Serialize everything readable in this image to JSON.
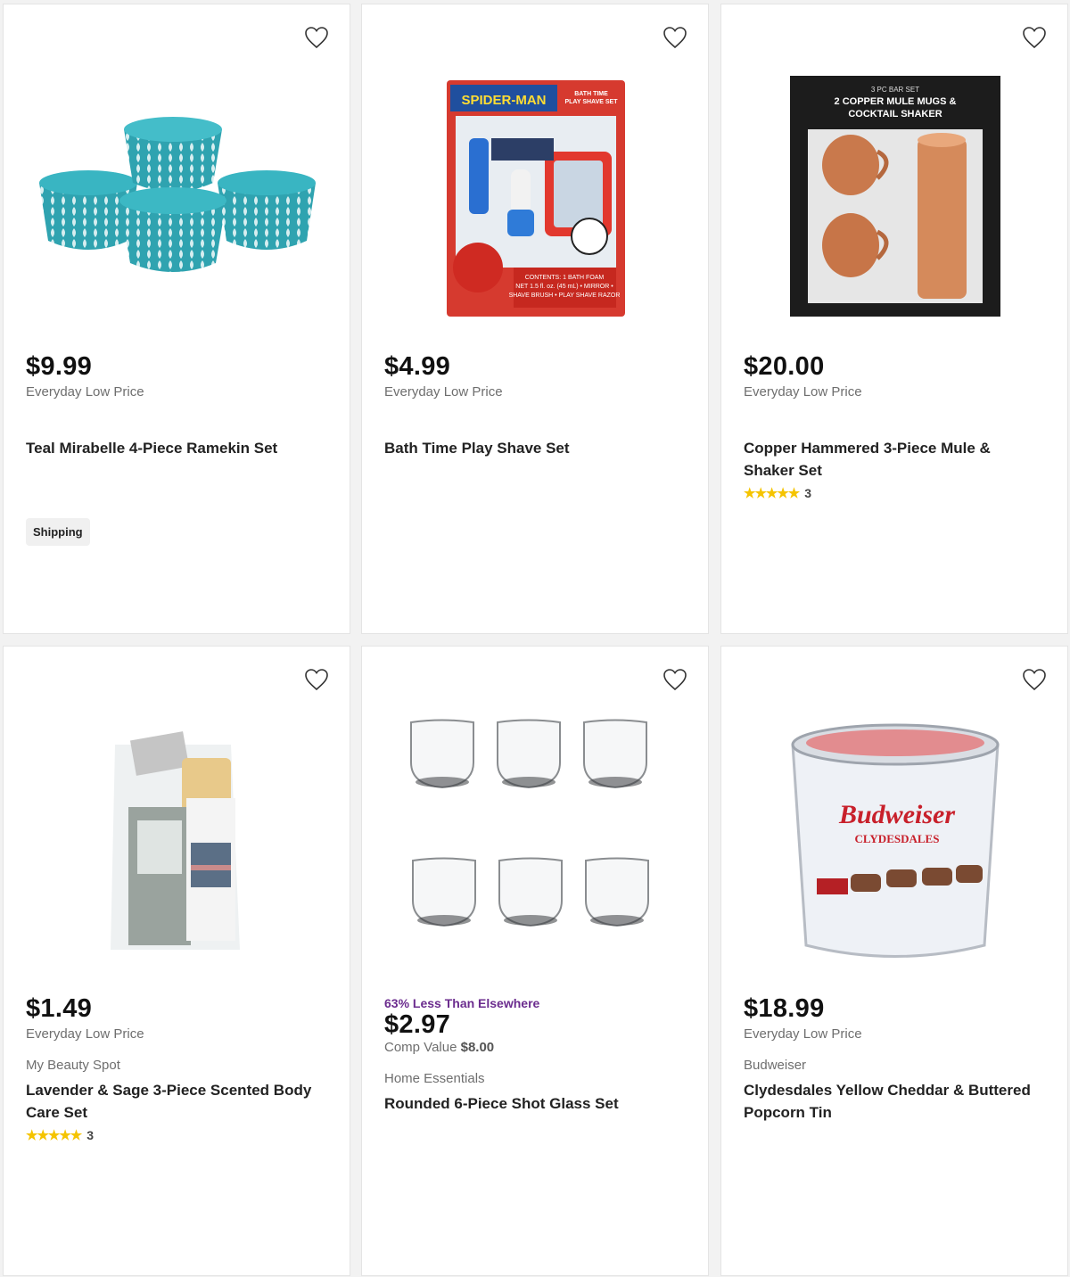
{
  "products": [
    {
      "price": "$9.99",
      "price_note": "Everyday Low Price",
      "brand": "",
      "title": "Teal Mirabelle 4-Piece Ramekin Set",
      "badge": "Shipping",
      "image": "teal-ramekin-bowls",
      "wishlist_icon": "heart-icon"
    },
    {
      "price": "$4.99",
      "price_note": "Everyday Low Price",
      "brand": "",
      "title": "Bath Time Play Shave Set",
      "image": "spider-man-play-shave-set",
      "image_text": {
        "brand": "SPIDER-MAN",
        "product": "BATH TIME PLAY SHAVE SET",
        "contents": "CONTENTS: 1 BATH FOAM NET 1.5 fl. oz. (45 mL) • MIRROR • SHAVE BRUSH • PLAY SHAVE RAZOR"
      },
      "wishlist_icon": "heart-icon"
    },
    {
      "price": "$20.00",
      "price_note": "Everyday Low Price",
      "brand": "",
      "title": "Copper Hammered 3-Piece Mule & Shaker Set",
      "rating": {
        "stars": 5,
        "count": "3"
      },
      "image": "copper-mule-mugs-box",
      "image_text": {
        "line1": "3 PC BAR SET",
        "line2": "2 COPPER MULE MUGS &",
        "line3": "COCKTAIL SHAKER"
      },
      "wishlist_icon": "heart-icon"
    },
    {
      "price": "$1.49",
      "price_note": "Everyday Low Price",
      "brand": "My Beauty Spot",
      "title": "Lavender & Sage 3-Piece Scented Body Care Set",
      "rating": {
        "stars": 5,
        "count": "3"
      },
      "image": "body-care-gift-set",
      "wishlist_icon": "heart-icon"
    },
    {
      "promo": "63% Less Than Elsewhere",
      "price": "$2.97",
      "comp_label": "Comp Value",
      "comp_value": "$8.00",
      "brand": "Home Essentials",
      "title": "Rounded 6-Piece Shot Glass Set",
      "image": "six-shot-glasses",
      "wishlist_icon": "heart-icon"
    },
    {
      "price": "$18.99",
      "price_note": "Everyday Low Price",
      "brand": "Budweiser",
      "title": "Clydesdales Yellow Cheddar & Buttered Popcorn Tin",
      "image": "budweiser-popcorn-tin",
      "image_text": {
        "logo": "Budweiser",
        "sub": "CLYDESDALES"
      },
      "wishlist_icon": "heart-icon"
    }
  ],
  "colors": {
    "promo": "#6b2c8e",
    "star": "#f5c400",
    "price": "#111111"
  }
}
